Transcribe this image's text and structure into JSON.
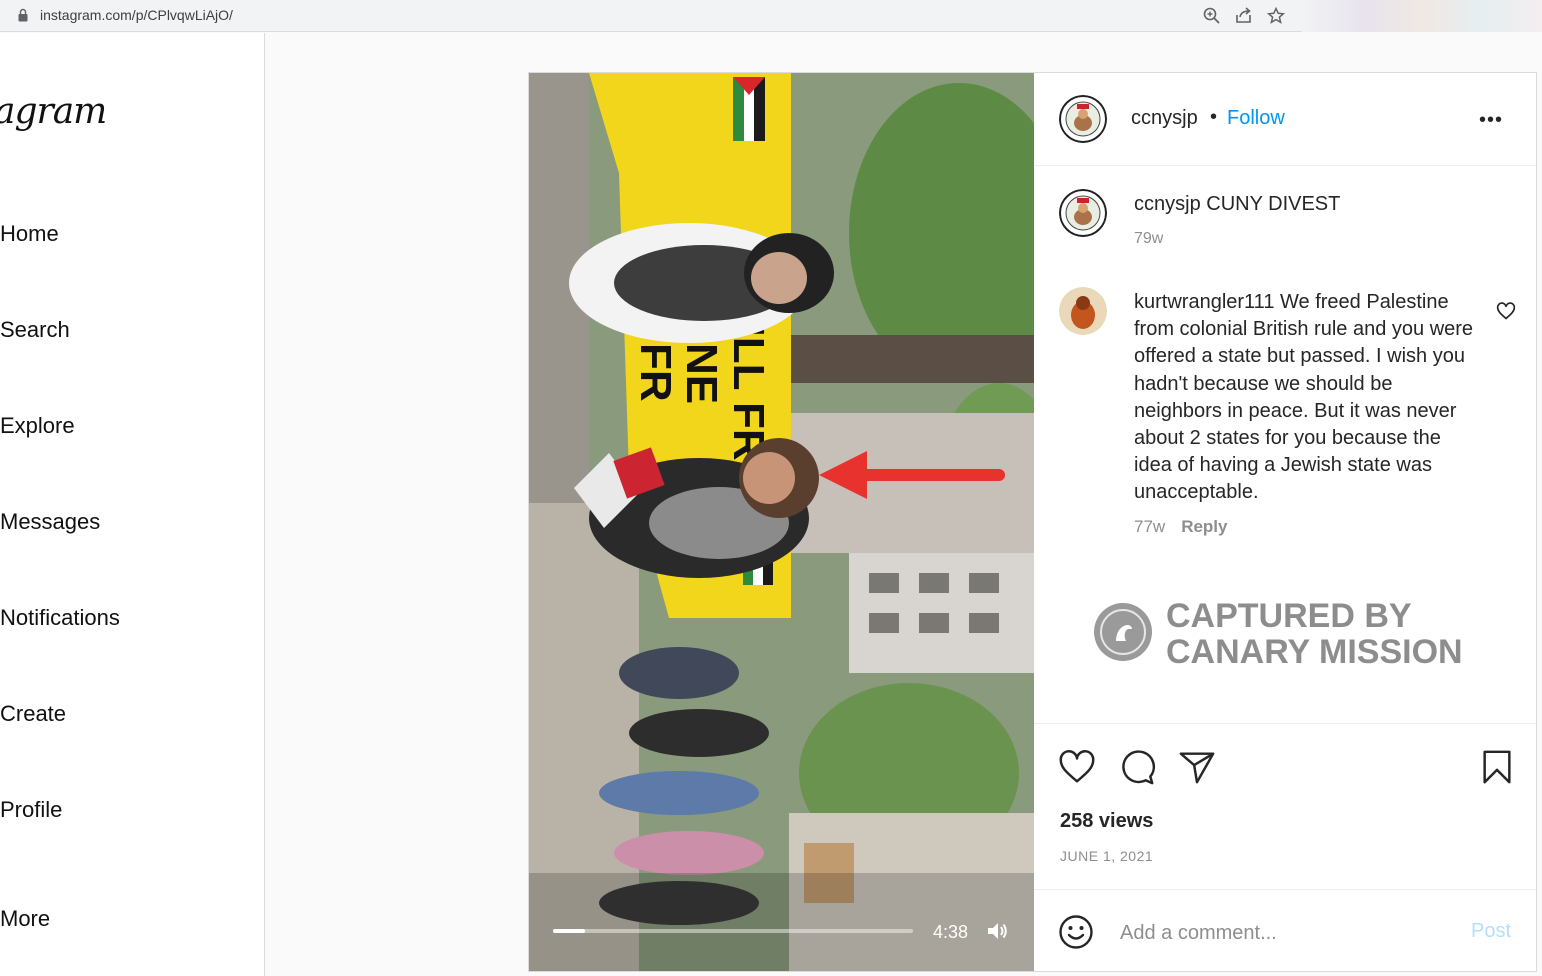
{
  "browser": {
    "url": "instagram.com/p/CPlvqwLiAjO/"
  },
  "sidebar": {
    "logo": "agram",
    "items": [
      {
        "label": "Home"
      },
      {
        "label": "Search"
      },
      {
        "label": "Explore"
      },
      {
        "label": "Messages"
      },
      {
        "label": "Notifications"
      },
      {
        "label": "Create"
      },
      {
        "label": "Profile"
      },
      {
        "label": "More"
      }
    ]
  },
  "post": {
    "username": "ccnysjp",
    "separator": "•",
    "follow_label": "Follow",
    "more_label": "•••",
    "caption": {
      "username": "ccnysjp",
      "text": " CUNY DIVEST",
      "time": "79w"
    },
    "comment": {
      "username": "kurtwrangler111",
      "text": " We freed Palestine from colonial British rule and you were offered a state but passed. I wish you hadn't because we should be neighbors in peace. But it was never about 2 states for you because the idea of having a Jewish state was unacceptable.",
      "time": "77w",
      "reply_label": "Reply"
    },
    "watermark": {
      "line1": "CAPTURED BY",
      "line2": "CANARY MISSION"
    },
    "views": "258 views",
    "date": "JUNE 1, 2021",
    "comment_placeholder": "Add a comment...",
    "post_label": "Post"
  },
  "video": {
    "time": "4:38",
    "progress_fraction": 0.09,
    "banner_text_1": "WILL FR",
    "banner_text_2": "NE",
    "banner_text_3": "FR"
  },
  "colors": {
    "link": "#0095f6",
    "banner": "#f2d61c",
    "arrow": "#e8322e"
  }
}
